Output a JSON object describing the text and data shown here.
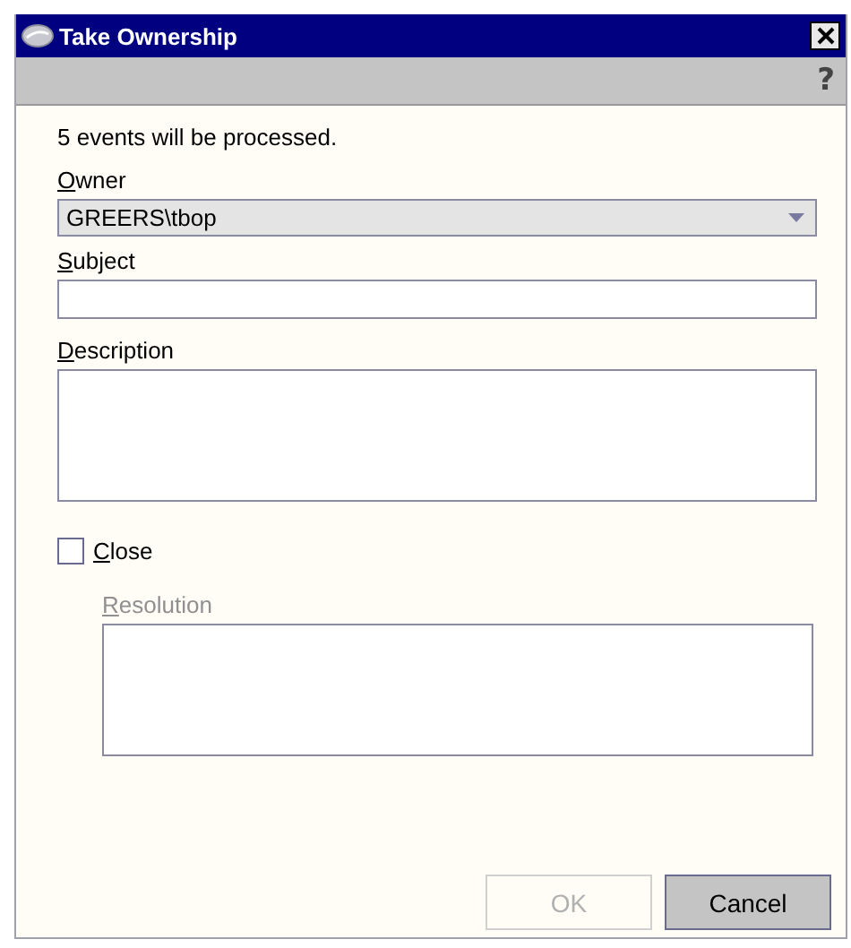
{
  "window": {
    "title": "Take Ownership"
  },
  "toolbar": {
    "help": "?"
  },
  "message": "5 events will be processed.",
  "owner": {
    "label": "Owner",
    "value": "GREERS\\tbop"
  },
  "subject": {
    "label": "Subject"
  },
  "description": {
    "label": "Description"
  },
  "close": {
    "label": "Close",
    "checked": false
  },
  "resolution": {
    "label": "Resolution",
    "disabled": true
  },
  "buttons": [
    {
      "label": "OK",
      "disabled": true
    },
    {
      "label": "Cancel",
      "disabled": false
    }
  ]
}
